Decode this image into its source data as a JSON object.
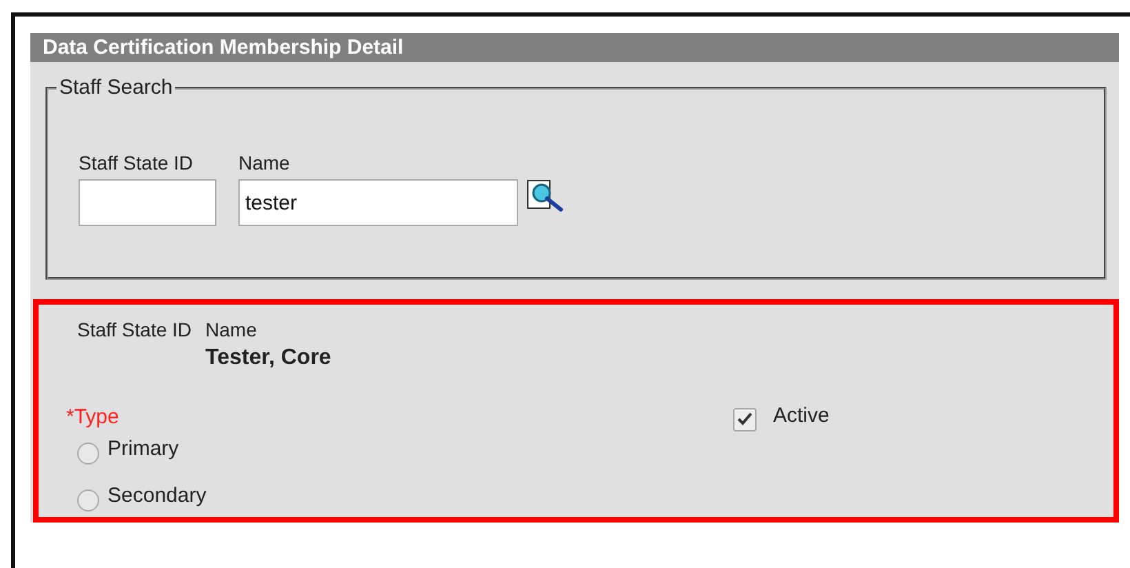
{
  "panel": {
    "title": "Data Certification Membership Detail"
  },
  "staff_search": {
    "legend": "Staff Search",
    "fields": [
      {
        "label": "Staff State ID"
      },
      {
        "label": "Name",
        "value": "tester"
      }
    ]
  },
  "selection": {
    "highlighted": true,
    "columns": [
      {
        "label": "Staff State ID"
      },
      {
        "label": "Name",
        "value": "Tester, Core"
      }
    ],
    "type": {
      "label": "*Type",
      "required": true,
      "options": [
        {
          "label": "Primary",
          "selected": false
        },
        {
          "label": "Secondary",
          "selected": false
        }
      ]
    },
    "active": {
      "label": "Active",
      "checked": true
    }
  }
}
